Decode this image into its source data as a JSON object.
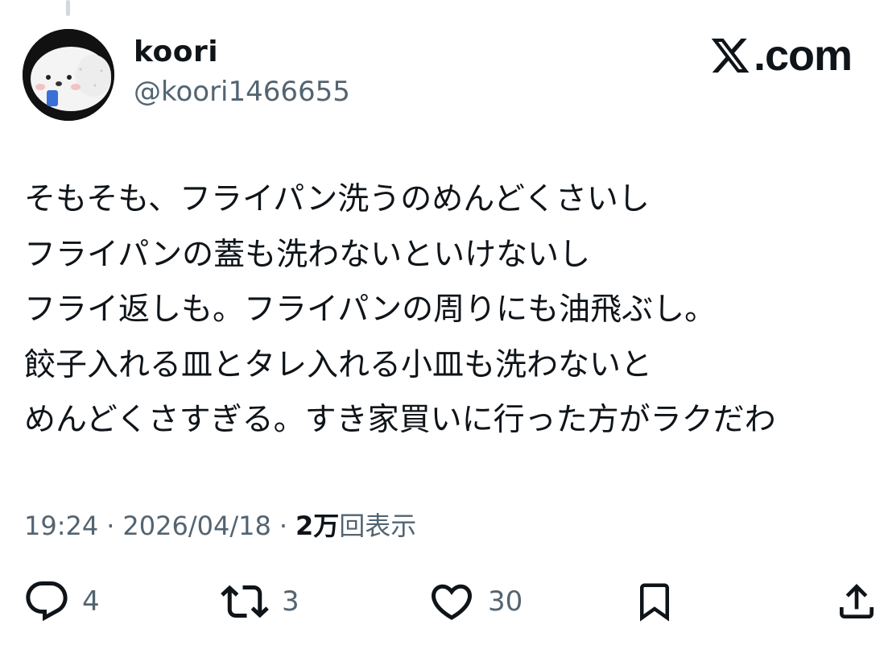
{
  "author": {
    "display_name": "koori",
    "handle": "@koori1466655"
  },
  "brand": {
    "label": ".com",
    "logo_icon": "x-logo-icon"
  },
  "tweet": {
    "lines": [
      "そもそも、フライパン洗うのめんどくさいし",
      "フライパンの蓋も洗わないといけないし",
      "フライ返しも。フライパンの周りにも油飛ぶし。",
      "餃子入れる皿とタレ入れる小皿も洗わないと",
      "めんどくさすぎる。すき家買いに行った方がラクだわ"
    ]
  },
  "meta": {
    "time": "19:24",
    "separator": "·",
    "date": "2026/04/18",
    "views_count": "2万",
    "views_label": "回表示"
  },
  "actions": {
    "reply_count": "4",
    "retweet_count": "3",
    "like_count": "30"
  },
  "colors": {
    "text_primary": "#0f1419",
    "text_secondary": "#536471"
  }
}
